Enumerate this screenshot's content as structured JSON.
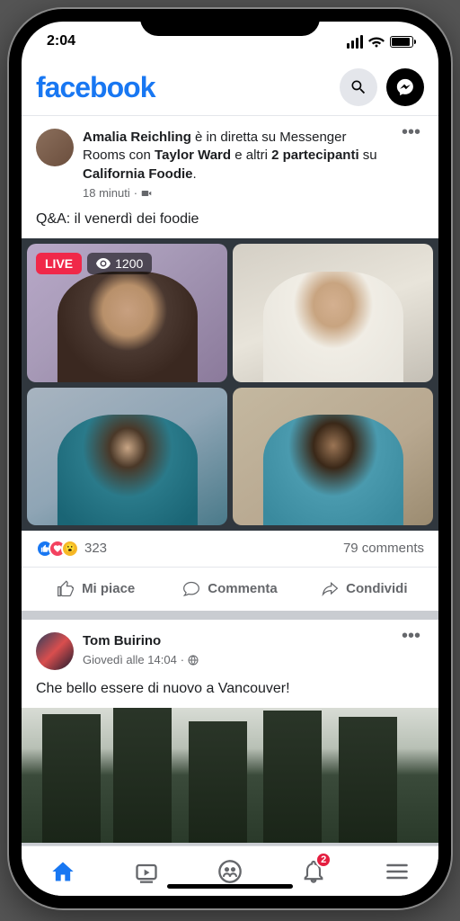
{
  "status": {
    "time": "2:04"
  },
  "header": {
    "logo": "facebook"
  },
  "post1": {
    "author": "Amalia Reichling",
    "connector1": " è in diretta su Messenger Rooms con ",
    "with": "Taylor Ward",
    "connector2": " e altri ",
    "others_count": "2 partecipanti",
    "connector3": " su ",
    "page": "California Foodie",
    "period": ".",
    "timestamp": "18 minuti",
    "text": "Q&A: il venerdì dei foodie",
    "live_label": "LIVE",
    "viewer_count": "1200",
    "reaction_count": "323",
    "comment_count": "79 comments"
  },
  "actions": {
    "like": "Mi piace",
    "comment": "Commenta",
    "share": "Condividi"
  },
  "post2": {
    "author": "Tom Buirino",
    "timestamp": "Giovedì alle 14:04",
    "text": "Che bello essere di nuovo a Vancouver!"
  },
  "tabs": {
    "notification_count": "2"
  }
}
